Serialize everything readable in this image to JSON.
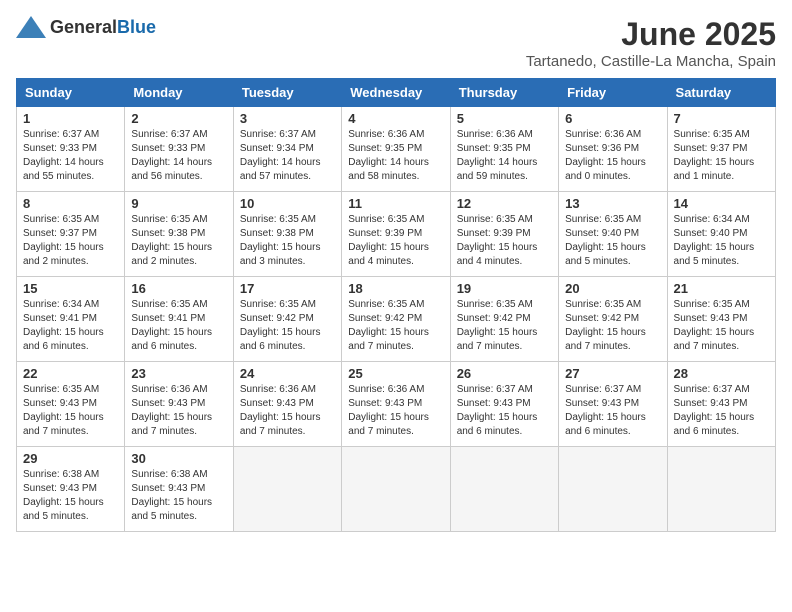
{
  "header": {
    "logo_general": "General",
    "logo_blue": "Blue",
    "title": "June 2025",
    "subtitle": "Tartanedo, Castille-La Mancha, Spain"
  },
  "calendar": {
    "days_of_week": [
      "Sunday",
      "Monday",
      "Tuesday",
      "Wednesday",
      "Thursday",
      "Friday",
      "Saturday"
    ],
    "weeks": [
      [
        {
          "num": "",
          "empty": true
        },
        {
          "num": "2",
          "sunrise": "6:37 AM",
          "sunset": "9:33 PM",
          "daylight": "14 hours and 56 minutes."
        },
        {
          "num": "3",
          "sunrise": "6:37 AM",
          "sunset": "9:34 PM",
          "daylight": "14 hours and 57 minutes."
        },
        {
          "num": "4",
          "sunrise": "6:36 AM",
          "sunset": "9:35 PM",
          "daylight": "14 hours and 58 minutes."
        },
        {
          "num": "5",
          "sunrise": "6:36 AM",
          "sunset": "9:35 PM",
          "daylight": "14 hours and 59 minutes."
        },
        {
          "num": "6",
          "sunrise": "6:36 AM",
          "sunset": "9:36 PM",
          "daylight": "15 hours and 0 minutes."
        },
        {
          "num": "7",
          "sunrise": "6:35 AM",
          "sunset": "9:37 PM",
          "daylight": "15 hours and 1 minute."
        }
      ],
      [
        {
          "num": "1",
          "sunrise": "6:37 AM",
          "sunset": "9:33 PM",
          "daylight": "14 hours and 55 minutes."
        },
        {
          "num": "9",
          "sunrise": "6:35 AM",
          "sunset": "9:38 PM",
          "daylight": "15 hours and 2 minutes."
        },
        {
          "num": "10",
          "sunrise": "6:35 AM",
          "sunset": "9:38 PM",
          "daylight": "15 hours and 3 minutes."
        },
        {
          "num": "11",
          "sunrise": "6:35 AM",
          "sunset": "9:39 PM",
          "daylight": "15 hours and 4 minutes."
        },
        {
          "num": "12",
          "sunrise": "6:35 AM",
          "sunset": "9:39 PM",
          "daylight": "15 hours and 4 minutes."
        },
        {
          "num": "13",
          "sunrise": "6:35 AM",
          "sunset": "9:40 PM",
          "daylight": "15 hours and 5 minutes."
        },
        {
          "num": "14",
          "sunrise": "6:34 AM",
          "sunset": "9:40 PM",
          "daylight": "15 hours and 5 minutes."
        }
      ],
      [
        {
          "num": "8",
          "sunrise": "6:35 AM",
          "sunset": "9:37 PM",
          "daylight": "15 hours and 2 minutes."
        },
        {
          "num": "16",
          "sunrise": "6:35 AM",
          "sunset": "9:41 PM",
          "daylight": "15 hours and 6 minutes."
        },
        {
          "num": "17",
          "sunrise": "6:35 AM",
          "sunset": "9:42 PM",
          "daylight": "15 hours and 6 minutes."
        },
        {
          "num": "18",
          "sunrise": "6:35 AM",
          "sunset": "9:42 PM",
          "daylight": "15 hours and 7 minutes."
        },
        {
          "num": "19",
          "sunrise": "6:35 AM",
          "sunset": "9:42 PM",
          "daylight": "15 hours and 7 minutes."
        },
        {
          "num": "20",
          "sunrise": "6:35 AM",
          "sunset": "9:42 PM",
          "daylight": "15 hours and 7 minutes."
        },
        {
          "num": "21",
          "sunrise": "6:35 AM",
          "sunset": "9:43 PM",
          "daylight": "15 hours and 7 minutes."
        }
      ],
      [
        {
          "num": "15",
          "sunrise": "6:34 AM",
          "sunset": "9:41 PM",
          "daylight": "15 hours and 6 minutes."
        },
        {
          "num": "23",
          "sunrise": "6:36 AM",
          "sunset": "9:43 PM",
          "daylight": "15 hours and 7 minutes."
        },
        {
          "num": "24",
          "sunrise": "6:36 AM",
          "sunset": "9:43 PM",
          "daylight": "15 hours and 7 minutes."
        },
        {
          "num": "25",
          "sunrise": "6:36 AM",
          "sunset": "9:43 PM",
          "daylight": "15 hours and 7 minutes."
        },
        {
          "num": "26",
          "sunrise": "6:37 AM",
          "sunset": "9:43 PM",
          "daylight": "15 hours and 6 minutes."
        },
        {
          "num": "27",
          "sunrise": "6:37 AM",
          "sunset": "9:43 PM",
          "daylight": "15 hours and 6 minutes."
        },
        {
          "num": "28",
          "sunrise": "6:37 AM",
          "sunset": "9:43 PM",
          "daylight": "15 hours and 6 minutes."
        }
      ],
      [
        {
          "num": "22",
          "sunrise": "6:35 AM",
          "sunset": "9:43 PM",
          "daylight": "15 hours and 7 minutes."
        },
        {
          "num": "30",
          "sunrise": "6:38 AM",
          "sunset": "9:43 PM",
          "daylight": "15 hours and 5 minutes."
        },
        {
          "num": "",
          "empty": true
        },
        {
          "num": "",
          "empty": true
        },
        {
          "num": "",
          "empty": true
        },
        {
          "num": "",
          "empty": true
        },
        {
          "num": "",
          "empty": true
        }
      ],
      [
        {
          "num": "29",
          "sunrise": "6:38 AM",
          "sunset": "9:43 PM",
          "daylight": "15 hours and 5 minutes."
        },
        {
          "num": "",
          "empty": true
        },
        {
          "num": "",
          "empty": true
        },
        {
          "num": "",
          "empty": true
        },
        {
          "num": "",
          "empty": true
        },
        {
          "num": "",
          "empty": true
        },
        {
          "num": "",
          "empty": true
        }
      ]
    ]
  }
}
